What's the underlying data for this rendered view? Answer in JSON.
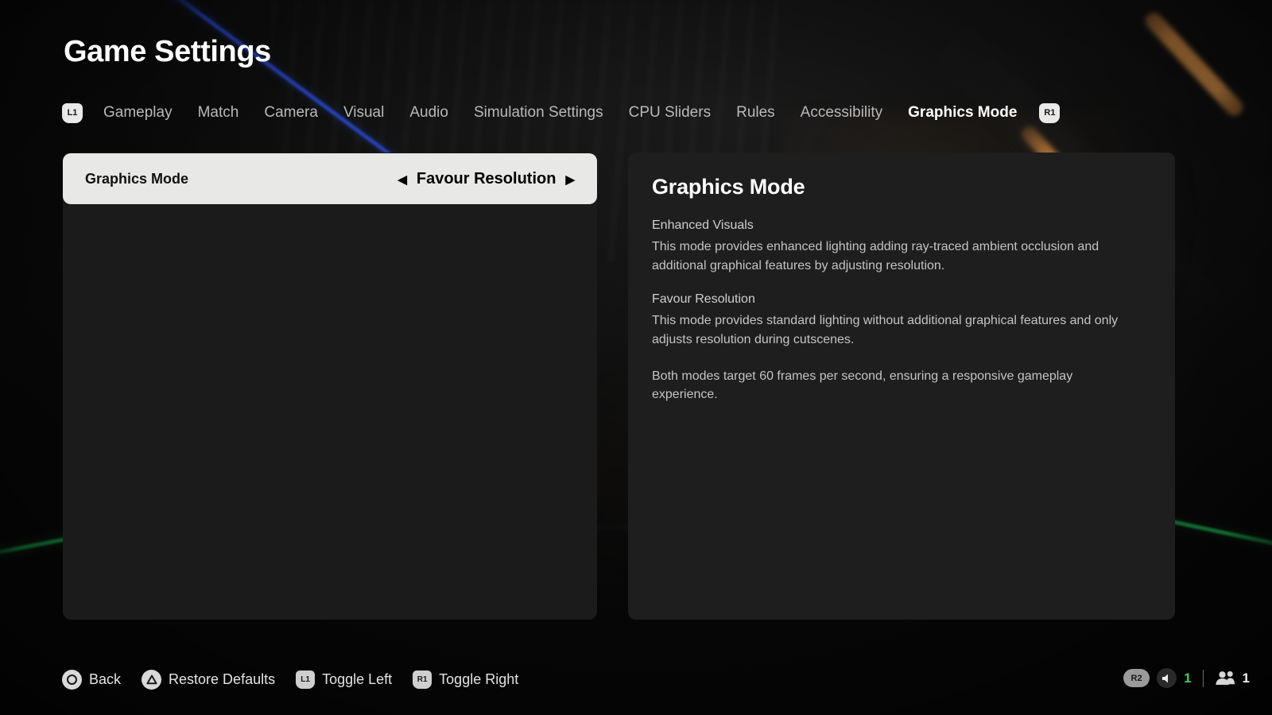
{
  "header": {
    "title": "Game Settings",
    "left_bumper": "L1",
    "right_bumper": "R1",
    "tabs": [
      {
        "label": "Gameplay",
        "active": false
      },
      {
        "label": "Match",
        "active": false
      },
      {
        "label": "Camera",
        "active": false
      },
      {
        "label": "Visual",
        "active": false
      },
      {
        "label": "Audio",
        "active": false
      },
      {
        "label": "Simulation Settings",
        "active": false
      },
      {
        "label": "CPU Sliders",
        "active": false
      },
      {
        "label": "Rules",
        "active": false
      },
      {
        "label": "Accessibility",
        "active": false
      },
      {
        "label": "Graphics Mode",
        "active": true
      }
    ]
  },
  "settings_list": {
    "rows": [
      {
        "label": "Graphics Mode",
        "value": "Favour Resolution",
        "left_arrow": "◀",
        "right_arrow": "▶",
        "selected": true
      }
    ]
  },
  "detail": {
    "title": "Graphics Mode",
    "blocks": [
      {
        "heading": "Enhanced Visuals",
        "body": "This mode provides enhanced lighting adding ray-traced ambient occlusion and additional graphical features by adjusting resolution."
      },
      {
        "heading": "Favour Resolution",
        "body": "This mode provides standard lighting without additional graphical features and only adjusts resolution during cutscenes."
      }
    ],
    "note": "Both modes target 60 frames per second, ensuring a responsive gameplay experience."
  },
  "footer": {
    "hints": [
      {
        "glyph": "circle-button-icon",
        "label": "Back"
      },
      {
        "glyph": "triangle-button-icon",
        "label": "Restore Defaults"
      },
      {
        "glyph": "l1-bumper-icon",
        "badge": "L1",
        "label": "Toggle Left"
      },
      {
        "glyph": "r1-bumper-icon",
        "badge": "R1",
        "label": "Toggle Right"
      }
    ],
    "status": {
      "trigger_badge": "R2",
      "volume_icon": "speaker-icon",
      "volume_level": "1",
      "players_icon": "players-icon",
      "player_count": "1"
    }
  },
  "theme": {
    "background": "#0a0a0a",
    "panel": "#1b1b1b",
    "panel_detail": "#1e1e1e",
    "selected_row": "#e8e8e6",
    "text_primary": "#ffffff",
    "text_muted": "#b9b9b9",
    "accent_green": "#3dcc63",
    "streak_blue": "#2b49c8",
    "streak_orange": "#c5823e",
    "streak_green": "#1aa34a"
  }
}
